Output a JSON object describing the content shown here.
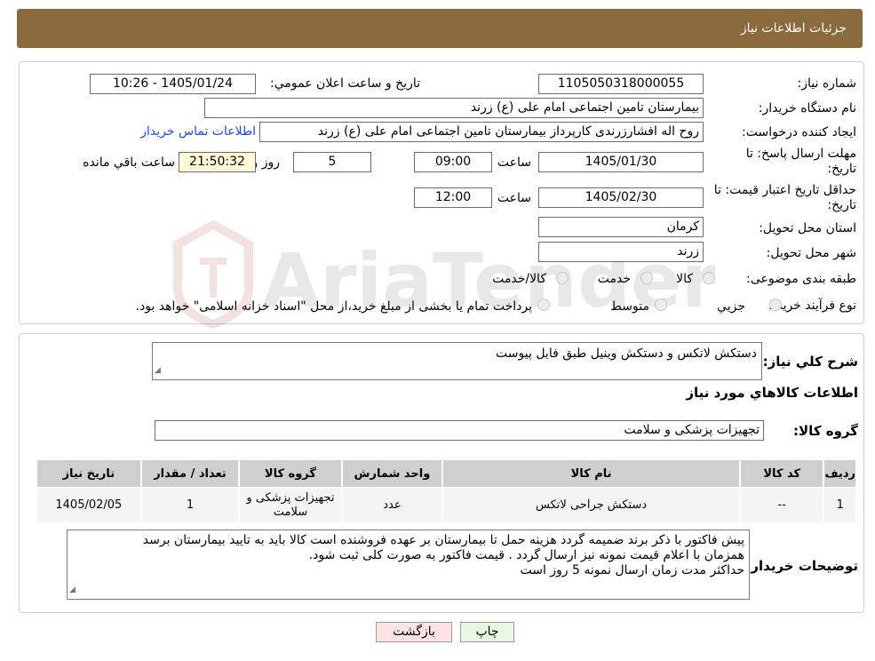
{
  "header": {
    "title": "جزئیات اطلاعات نیاز"
  },
  "need_number": {
    "label": "شماره نیاز:",
    "value": "1105050318000055"
  },
  "announce": {
    "label": "تاریخ و ساعت اعلان عمومي:",
    "value": "1405/01/24 - 10:26"
  },
  "buyer_org": {
    "label": "نام دستگاه خریدار:",
    "value": "بیمارستان تامین اجتماعی امام علی (ع) زرند"
  },
  "requester": {
    "label": "ایجاد کننده درخواست:",
    "value": "روح اله افشارزرندی کارپرداز بیمارستان تامین اجتماعی امام علی (ع) زرند",
    "contact_link": "اطلاعات تماس خریدار"
  },
  "deadline": {
    "label": "مهلت ارسال پاسخ: تا تاریخ:",
    "date": "1405/01/30",
    "time_label": "ساعت",
    "time": "09:00",
    "days": "5",
    "days_label": "روز و",
    "remaining": "21:50:32",
    "remaining_label": "ساعت باقي مانده"
  },
  "validity": {
    "label": "حداقل تاریخ اعتبار قیمت: تا تاریخ:",
    "date": "1405/02/30",
    "time_label": "ساعت",
    "time": "12:00"
  },
  "province": {
    "label": "استان محل تحویل:",
    "value": "کرمان"
  },
  "city": {
    "label": "شهر محل تحویل:",
    "value": "زرند"
  },
  "category": {
    "label": "طبقه بندی موضوعی:",
    "options": [
      "کالا",
      "خدمت",
      "کالا/خدمت"
    ]
  },
  "process": {
    "label": "نوع فرآیند خرید :",
    "options": [
      "جزیي",
      "متوسط"
    ],
    "note": "پرداخت تمام یا بخشی از مبلغ خرید،از محل \"اسناد خزانه اسلامی\" خواهد بود."
  },
  "watermark": {
    "text": "AriaTender.neT"
  },
  "summary": {
    "label": "شرح کلي نیاز:",
    "value": "دستکش لاتکس و دستکش وینیل طبق فایل پیوست"
  },
  "goods_section": {
    "title": "اطلاعات کالاهاي مورد نیاز"
  },
  "goods_group": {
    "label": "گروه کالا:",
    "value": "تجهیزات پزشکی و سلامت"
  },
  "table": {
    "headers": [
      "ردیف",
      "کد کالا",
      "نام کالا",
      "واحد شمارش",
      "گروه کالا",
      "تعداد / مقدار",
      "تاریخ نیاز"
    ],
    "rows": [
      [
        "1",
        "--",
        "دستکش جراحی لاتکس",
        "عدد",
        "تجهیزات پزشکی و سلامت",
        "1",
        "1405/02/05"
      ]
    ]
  },
  "buyer_notes": {
    "label": "توضیحات خریدار:",
    "lines": [
      "پیش فاکتور با ذکر برند ضمیمه گردد هزینه حمل تا بیمارستان بر عهده فروشنده است کالا باید به تایید بیمارستان برسد",
      "همزمان با اعلام قیمت نمونه نیز ارسال گردد . قیمت فاکتور به صورت کلی ثبت شود.",
      "حداکثر مدت زمان ارسال نمونه 5 روز است"
    ]
  },
  "buttons": {
    "print": "چاپ",
    "back": "بازگشت"
  },
  "colors": {
    "header_bg": "#8b6a3d",
    "link": "#1a4fd8",
    "print_bg": "#e8f7e0",
    "back_bg": "#fde2e2"
  }
}
